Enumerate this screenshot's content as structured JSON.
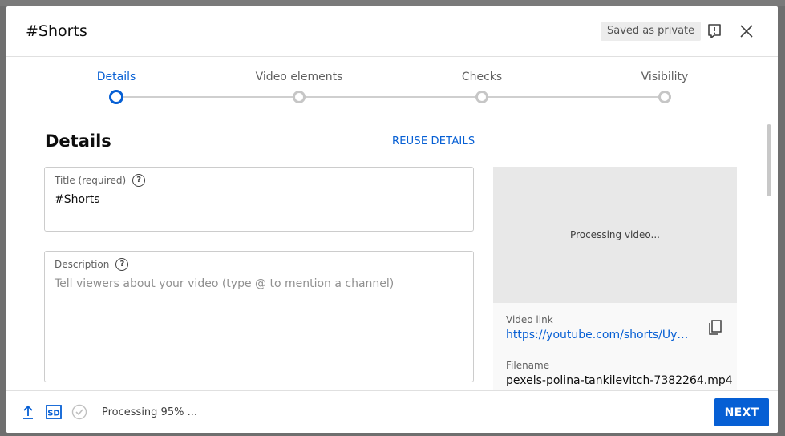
{
  "dialog": {
    "title": "#Shorts",
    "saved_badge": "Saved as private"
  },
  "stepper": {
    "steps": [
      {
        "label": "Details",
        "active": true
      },
      {
        "label": "Video elements",
        "active": false
      },
      {
        "label": "Checks",
        "active": false
      },
      {
        "label": "Visibility",
        "active": false
      }
    ]
  },
  "details": {
    "section_title": "Details",
    "reuse_label": "REUSE DETAILS",
    "title_field": {
      "label": "Title (required)",
      "value": "#Shorts"
    },
    "description_field": {
      "label": "Description",
      "placeholder": "Tell viewers about your video (type @ to mention a channel)"
    }
  },
  "side_panel": {
    "preview_status": "Processing video...",
    "video_link_label": "Video link",
    "video_link": "https://youtube.com/shorts/Uy…",
    "filename_label": "Filename",
    "filename": "pexels-polina-tankilevitch-7382264.mp4"
  },
  "footer": {
    "sd_badge": "SD",
    "status": "Processing 95% ...",
    "next_label": "NEXT"
  },
  "colors": {
    "accent": "#065fd4",
    "badge_bg": "#ececec"
  },
  "icons": [
    "report-icon",
    "close-icon",
    "help-icon",
    "copy-icon",
    "upload-icon",
    "sd-icon",
    "check-circle-icon"
  ]
}
